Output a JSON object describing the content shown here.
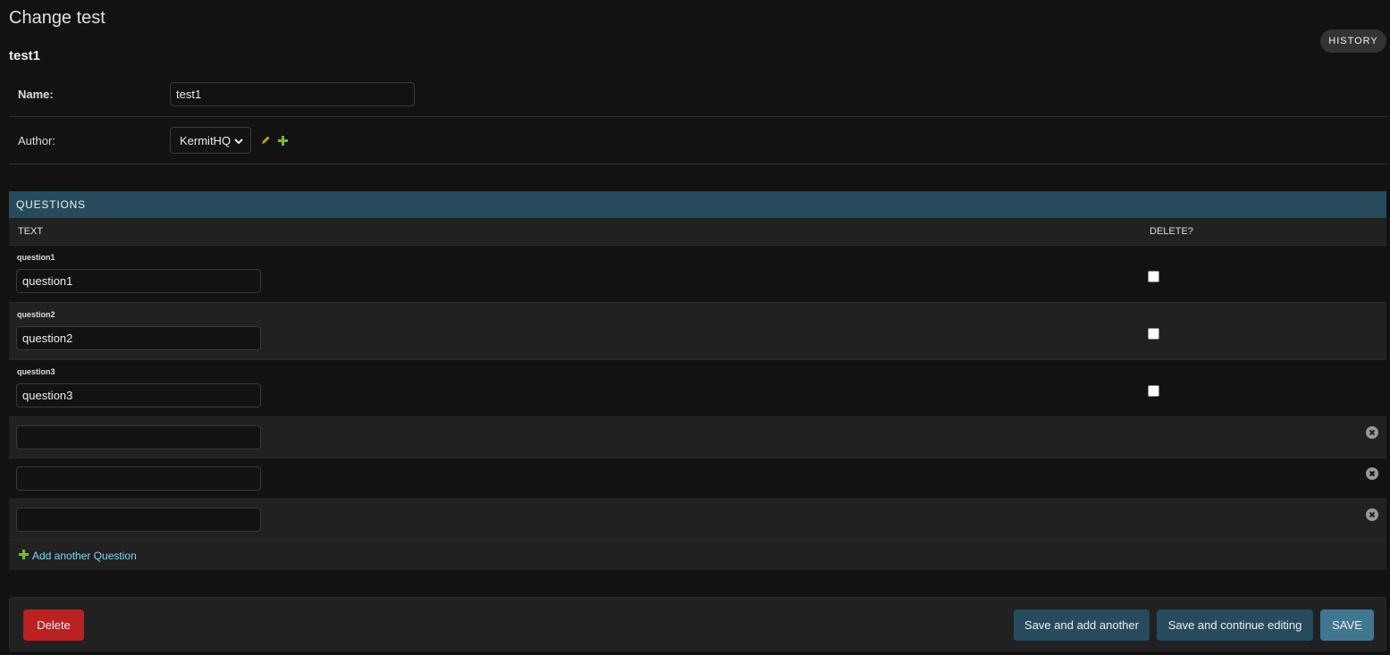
{
  "header": {
    "title": "Change test",
    "object_title": "test1",
    "history_label": "HISTORY"
  },
  "form": {
    "name_label": "Name:",
    "name_value": "test1",
    "author_label": "Author:",
    "author_selected": "KermitHQ"
  },
  "inline": {
    "group_title": "QUESTIONS",
    "col_text": "TEXT",
    "col_delete": "DELETE?",
    "rows": [
      {
        "original": "question1",
        "value": "question1",
        "delete_checked": false
      },
      {
        "original": "question2",
        "value": "question2",
        "delete_checked": false
      },
      {
        "original": "question3",
        "value": "question3",
        "delete_checked": false
      }
    ],
    "extra_rows": [
      {
        "value": ""
      },
      {
        "value": ""
      },
      {
        "value": ""
      }
    ],
    "add_label": "Add another Question"
  },
  "submit": {
    "delete_label": "Delete",
    "save_add_label": "Save and add another",
    "save_continue_label": "Save and continue editing",
    "save_label": "SAVE"
  },
  "colors": {
    "header_bg": "#264b5d",
    "delete_red": "#ba2121",
    "save_blue": "#417690",
    "link_blue": "#81d4fa",
    "add_green": "#70bf2b",
    "edit_yellow": "#c8a200"
  }
}
